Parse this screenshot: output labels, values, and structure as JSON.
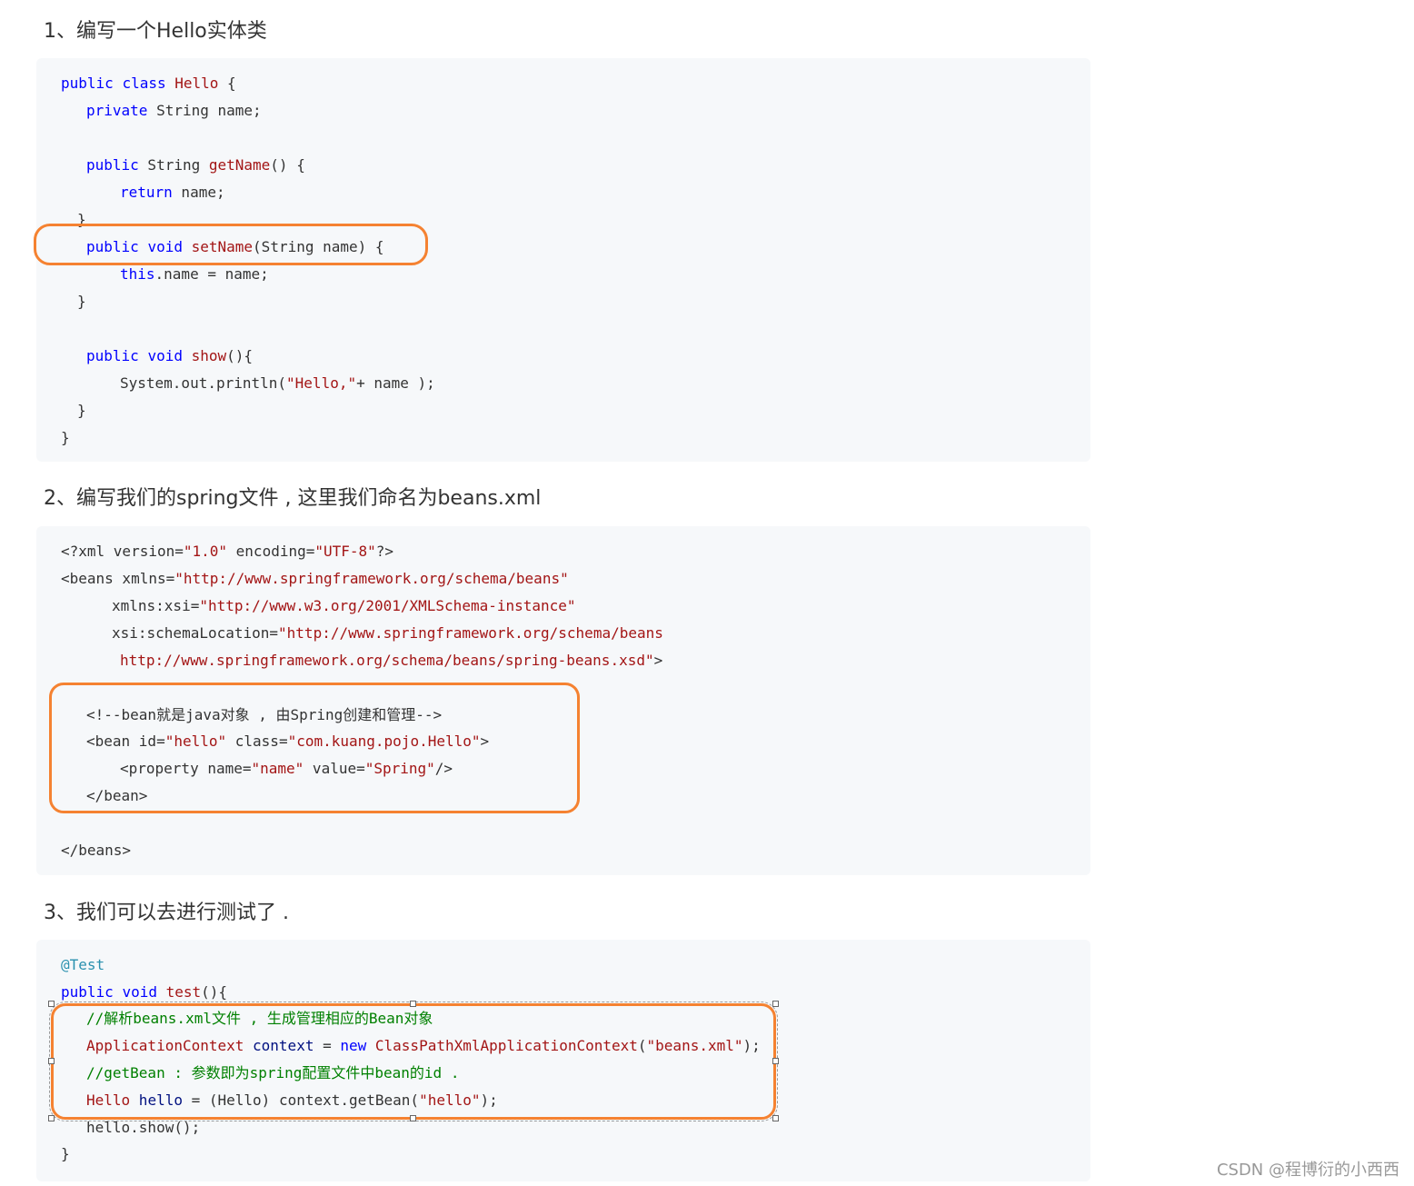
{
  "headings": {
    "step1": "1、编写一个Hello实体类",
    "step2": "2、编写我们的spring文件 , 这里我们命名为beans.xml",
    "step3": "3、我们可以去进行测试了 ."
  },
  "code1": {
    "l1_kw1": "public",
    "l1_kw2": "class",
    "l1_name": "Hello",
    "l1_rest": " {",
    "l2_kw": "private",
    "l2_rest": " String name;",
    "l3_kw": "public",
    "l3_mid": " String ",
    "l3_fn": "getName",
    "l3_rest": "() {",
    "l4_kw": "return",
    "l4_rest": " name;",
    "l5": "}",
    "l6_kw1": "public",
    "l6_kw2": "void",
    "l6_fn": "setName",
    "l6_rest": "(String name) {",
    "l7_kw": "this",
    "l7_rest": ".name = name;",
    "l8": "}",
    "l9_kw1": "public",
    "l9_kw2": "void",
    "l9_fn": "show",
    "l9_rest": "(){",
    "l10_pre": "System.out.println(",
    "l10_str": "\"Hello,\"",
    "l10_rest": "+ name );",
    "l11": "}",
    "l12": "}"
  },
  "code2": {
    "l1_a": "<?xml version=",
    "l1_s1": "\"1.0\"",
    "l1_b": " encoding=",
    "l1_s2": "\"UTF-8\"",
    "l1_c": "?>",
    "l2_a": "<beans xmlns=",
    "l2_s": "\"http://www.springframework.org/schema/beans\"",
    "l3_a": "xmlns:xsi=",
    "l3_s": "\"http://www.w3.org/2001/XMLSchema-instance\"",
    "l4_a": "xsi:schemaLocation=",
    "l4_s": "\"http://www.springframework.org/schema/beans",
    "l5_s": "http://www.springframework.org/schema/beans/spring-beans.xsd\"",
    "l5_c": ">",
    "l6": "<!--bean就是java对象 , 由Spring创建和管理-->",
    "l7_a": "<bean id=",
    "l7_s1": "\"hello\"",
    "l7_b": " class=",
    "l7_s2": "\"com.kuang.pojo.Hello\"",
    "l7_c": ">",
    "l8_a": "<property name=",
    "l8_s1": "\"name\"",
    "l8_b": " value=",
    "l8_s2": "\"Spring\"",
    "l8_c": "/>",
    "l9": "</bean>",
    "l10": "</beans>"
  },
  "code3": {
    "l1": "@Test",
    "l2_kw1": "public",
    "l2_kw2": "void",
    "l2_fn": "test",
    "l2_rest": "(){",
    "l3": "//解析beans.xml文件 , 生成管理相应的Bean对象",
    "l4_ty": "ApplicationContext",
    "l4_var": " context",
    "l4_eq": " = ",
    "l4_kw": "new",
    "l4_ty2": " ClassPathXmlApplicationContext",
    "l4_p": "(",
    "l4_s": "\"beans.xml\"",
    "l4_e": ");",
    "l5": "//getBean : 参数即为spring配置文件中bean的id .",
    "l6_ty": "Hello",
    "l6_var": " hello",
    "l6_eq": " = ",
    "l6_rest": "(Hello) context.getBean(",
    "l6_s": "\"hello\"",
    "l6_e": ");",
    "l7": "hello.show();",
    "l8": "}"
  },
  "watermark": "CSDN @程博衍的小西西",
  "colors": {
    "highlight": "#f58231",
    "keyword": "#0000ff",
    "string": "#a31515",
    "comment": "#008000",
    "code_bg": "#f6f8fa"
  }
}
